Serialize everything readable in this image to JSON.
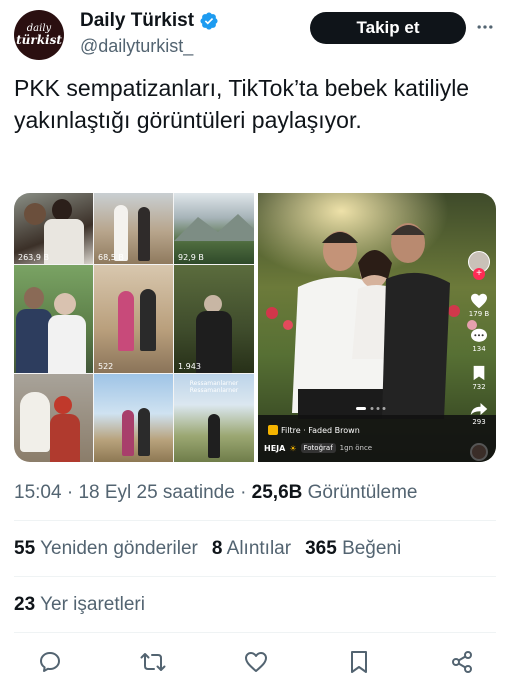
{
  "account": {
    "avatar_text_line1": "daily",
    "avatar_text_line2": "türkist",
    "display_name": "Daily Türkist",
    "handle": "@dailyturkist_",
    "follow_label": "Takip et"
  },
  "tweet": {
    "text": "PKK sempatizanları, TikTok’ta bebek katiliyle yakınlaştığı görüntüleri paylaşıyor."
  },
  "media": {
    "grid_counts": [
      "263,9 B",
      "68,5 B",
      "92,9 B",
      "",
      "522",
      "1.943",
      "",
      "",
      ""
    ],
    "grid_caption": "Ressamanlarner Ressamanlarner",
    "side": {
      "likes": "179 B",
      "comments": "134",
      "bookmarks": "732",
      "shares": "293"
    },
    "filter_label": "Filtre · Faded Brown",
    "author": "HEJA",
    "photo_label": "Fotoğraf",
    "time_ago": "1gn önce"
  },
  "meta": {
    "time": "15:04",
    "date": "18 Eyl 25 saatinde",
    "views_count": "25,6B",
    "views_label": "Görüntüleme"
  },
  "stats": {
    "retweets_count": "55",
    "retweets_label": "Yeniden gönderiler",
    "quotes_count": "8",
    "quotes_label": "Alıntılar",
    "likes_count": "365",
    "likes_label": "Beğeni"
  },
  "bookmarks": {
    "count": "23",
    "label": "Yer işaretleri"
  },
  "colors": {
    "text": "#0f1419",
    "secondary": "#536471",
    "verified": "#1d9bf0",
    "divider": "#eff3f4"
  }
}
